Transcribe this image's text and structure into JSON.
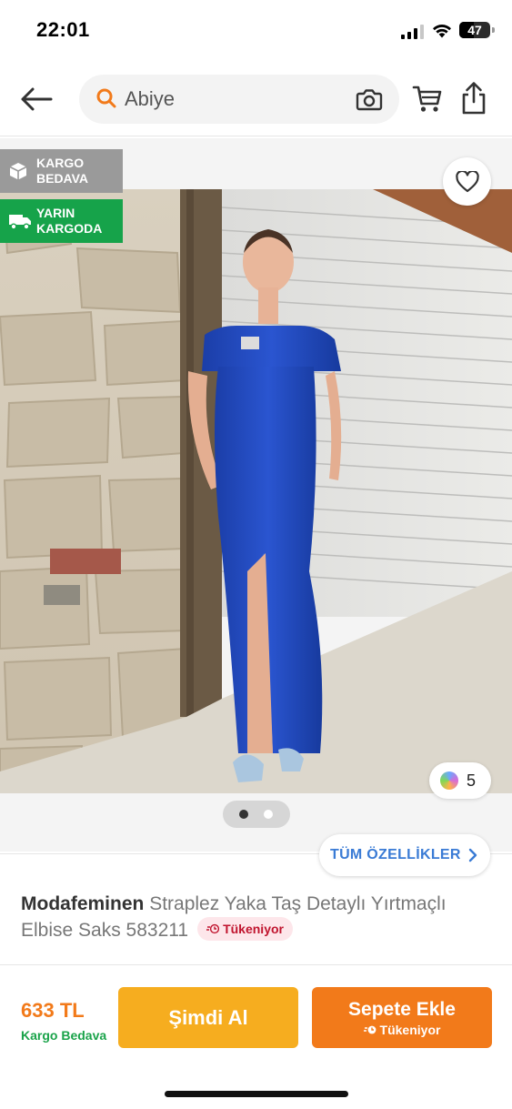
{
  "status_bar": {
    "time": "22:01",
    "battery_level": "47",
    "battery_fraction": 0.47
  },
  "header": {
    "search_value": "Abiye"
  },
  "badges": {
    "cargo_free_line1": "KARGO",
    "cargo_free_line2": "BEDAVA",
    "tomorrow_line1": "YARIN",
    "tomorrow_line2": "KARGODA"
  },
  "gallery": {
    "variant_count": "5",
    "image_count": 2,
    "active_image": 1
  },
  "features_button": "TÜM ÖZELLİKLER",
  "product": {
    "brand": "Modafeminen",
    "name": "Straplez Yaka Taş Detaylı Yırtmaçlı Elbise Saks 583211",
    "soldout_label": "Tükeniyor"
  },
  "purchase": {
    "price": "633 TL",
    "shipping_note": "Kargo Bedava",
    "buy_now_label": "Şimdi Al",
    "add_to_cart_label": "Sepete Ekle",
    "add_to_cart_sub": "Tükeniyor"
  },
  "colors": {
    "brand_orange": "#f27a1a",
    "buy_now_yellow": "#f6ad1f",
    "free_ship_green": "#1aa34a",
    "link_blue": "#3a7bd5",
    "soldout_red": "#c0142e"
  },
  "icons": [
    "back-arrow-icon",
    "search-icon",
    "camera-icon",
    "cart-icon",
    "share-icon",
    "box-icon",
    "truck-icon",
    "heart-icon",
    "chevron-right-icon",
    "clock-icon"
  ]
}
